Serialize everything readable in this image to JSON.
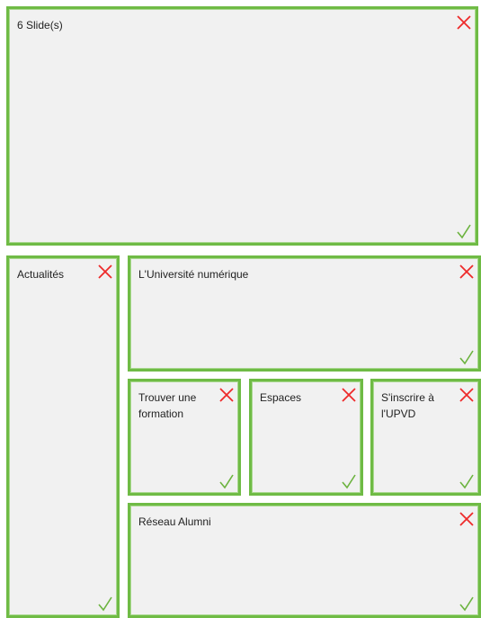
{
  "tiles": {
    "slides": {
      "label": "6 Slide(s)"
    },
    "actualites": {
      "label": "Actualités"
    },
    "universite_numerique": {
      "label": "L'Université numérique"
    },
    "trouver_formation": {
      "label": "Trouver une formation"
    },
    "espaces": {
      "label": "Espaces"
    },
    "sinscrire": {
      "label": "S'inscrire à l'UPVD"
    },
    "reseau_alumni": {
      "label": "Réseau Alumni"
    }
  },
  "icons": {
    "remove": "close-icon",
    "confirm": "check-icon"
  },
  "colors": {
    "tile_border": "#6fbb45",
    "tile_background": "#f1f1f1",
    "remove_icon": "#ee2a2a",
    "confirm_icon": "#6cb33f"
  }
}
